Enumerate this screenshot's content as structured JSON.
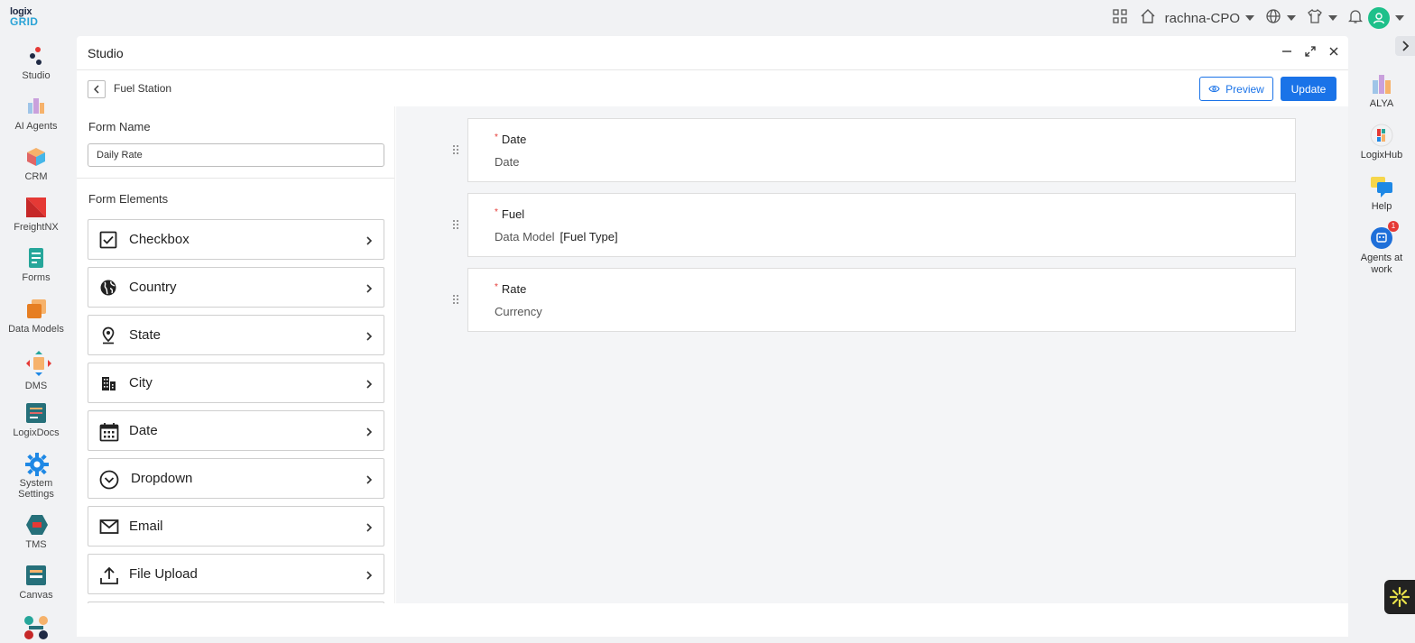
{
  "brand": {
    "line1": "logix",
    "line2": "GRID"
  },
  "topbar": {
    "workspace": "rachna-CPO"
  },
  "left_nav": [
    {
      "label": "Studio"
    },
    {
      "label": "AI Agents"
    },
    {
      "label": "CRM"
    },
    {
      "label": "FreightNX"
    },
    {
      "label": "Forms"
    },
    {
      "label": "Data Models"
    },
    {
      "label": "DMS"
    },
    {
      "label": "LogixDocs"
    },
    {
      "label": "System Settings"
    },
    {
      "label": "TMS"
    },
    {
      "label": "Canvas"
    }
  ],
  "right_rail": [
    {
      "label": "ALYA"
    },
    {
      "label": "LogixHub"
    },
    {
      "label": "Help"
    },
    {
      "label": "Agents at work",
      "badge": "1"
    }
  ],
  "studio": {
    "title": "Studio",
    "breadcrumb": "Fuel Station",
    "preview_label": "Preview",
    "update_label": "Update"
  },
  "form": {
    "name_label": "Form Name",
    "name_value": "Daily Rate",
    "elements_label": "Form Elements",
    "elements": [
      {
        "label": "Checkbox",
        "icon": "checkbox-icon"
      },
      {
        "label": "Country",
        "icon": "globe-icon"
      },
      {
        "label": "State",
        "icon": "location-pin-icon"
      },
      {
        "label": "City",
        "icon": "city-icon"
      },
      {
        "label": "Date",
        "icon": "calendar-icon"
      },
      {
        "label": "Dropdown",
        "icon": "dropdown-circle-icon"
      },
      {
        "label": "Email",
        "icon": "mail-icon"
      },
      {
        "label": "File Upload",
        "icon": "upload-icon"
      }
    ]
  },
  "fields": [
    {
      "required": "*",
      "label": "Date",
      "type": "Date",
      "value": ""
    },
    {
      "required": "*",
      "label": "Fuel",
      "type": "Data Model",
      "value": "[Fuel Type]"
    },
    {
      "required": "*",
      "label": "Rate",
      "type": "Currency",
      "value": ""
    }
  ],
  "colors": {
    "primary": "#1a73e8",
    "required": "#e53935",
    "avatar": "#1ec08a"
  }
}
